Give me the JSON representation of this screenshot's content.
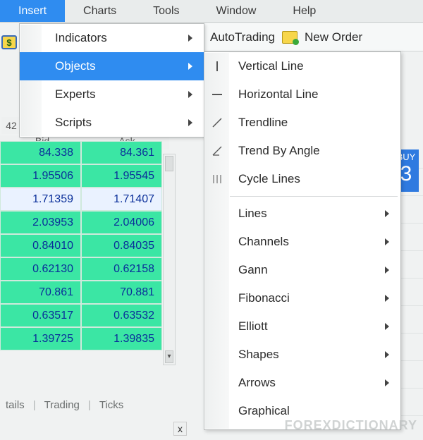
{
  "menubar": {
    "insert": "Insert",
    "charts": "Charts",
    "tools": "Tools",
    "window": "Window",
    "help": "Help"
  },
  "toolbar": {
    "autotrading": "AutoTrading",
    "new_order": "New Order"
  },
  "dropdown1": {
    "indicators": "Indicators",
    "objects": "Objects",
    "experts": "Experts",
    "scripts": "Scripts"
  },
  "dropdown2": {
    "vertical_line": "Vertical Line",
    "horizontal_line": "Horizontal Line",
    "trendline": "Trendline",
    "trend_by_angle": "Trend By Angle",
    "cycle_lines": "Cycle Lines",
    "lines": "Lines",
    "channels": "Channels",
    "gann": "Gann",
    "fibonacci": "Fibonacci",
    "elliott": "Elliott",
    "shapes": "Shapes",
    "arrows": "Arrows",
    "graphical": "Graphical"
  },
  "market_headers": {
    "bid": "Bid",
    "ask": "Ask"
  },
  "misc_label": "42",
  "market_rows": [
    {
      "bid": "84.338",
      "ask": "84.361",
      "hl": false
    },
    {
      "bid": "1.95506",
      "ask": "1.95545",
      "hl": false
    },
    {
      "bid": "1.71359",
      "ask": "1.71407",
      "hl": true
    },
    {
      "bid": "2.03953",
      "ask": "2.04006",
      "hl": false
    },
    {
      "bid": "0.84010",
      "ask": "0.84035",
      "hl": false
    },
    {
      "bid": "0.62130",
      "ask": "0.62158",
      "hl": false
    },
    {
      "bid": "70.861",
      "ask": "70.881",
      "hl": false
    },
    {
      "bid": "0.63517",
      "ask": "0.63532",
      "hl": false
    },
    {
      "bid": "1.39725",
      "ask": "1.39835",
      "hl": false
    }
  ],
  "tabs": {
    "tails": "tails",
    "trading": "Trading",
    "ticks": "Ticks"
  },
  "buy": {
    "label": "BUY",
    "big": "3"
  },
  "dollar": "$",
  "close": "x",
  "watermark": "FOREXDICTIONARY"
}
